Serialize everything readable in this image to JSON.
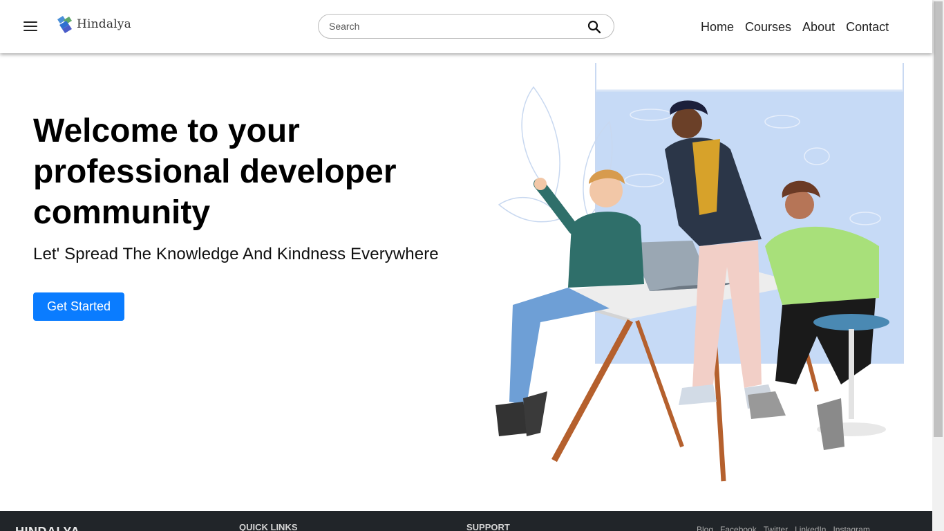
{
  "brand": {
    "name": "Hindalya",
    "logo_icon": "hindalya-logo-icon"
  },
  "navbar": {
    "menu_icon": "hamburger-menu-icon",
    "search": {
      "placeholder": "Search",
      "value": "",
      "icon": "search-icon"
    },
    "links": [
      "Home",
      "Courses",
      "About",
      "Contact"
    ]
  },
  "hero": {
    "title": "Welcome to your professional developer community",
    "subtitle": "Let' Spread The Knowledge And Kindness Everywhere",
    "cta_label": "Get Started",
    "cta_color": "#0a7cff"
  },
  "footer": {
    "brand": "HINDALYA",
    "quick_links_heading": "QUICK LINKS",
    "support_heading": "SUPPORT",
    "social_links": [
      "Blog",
      "Facebook",
      "Twitter",
      "LinkedIn",
      "Instagram"
    ]
  }
}
